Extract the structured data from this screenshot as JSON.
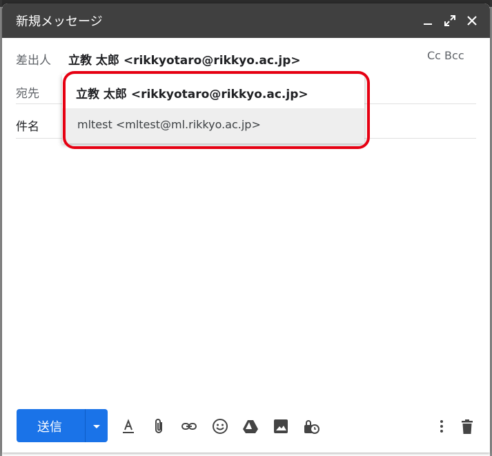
{
  "window": {
    "title": "新規メッセージ"
  },
  "header": {
    "from_label": "差出人",
    "from_value": "立教 太郎 <rikkyotaro@rikkyo.ac.jp>",
    "cc_bcc": "Cc Bcc",
    "to_label": "宛先",
    "subject_label": "件名"
  },
  "from_dropdown": {
    "options": [
      {
        "label": "立教 太郎 <rikkyotaro@rikkyo.ac.jp>"
      },
      {
        "label": "mltest <mltest@ml.rikkyo.ac.jp>"
      }
    ]
  },
  "toolbar": {
    "send_label": "送信",
    "icons": [
      "format-text-icon",
      "attach-icon",
      "link-icon",
      "emoji-icon",
      "drive-icon",
      "image-icon",
      "confidential-icon",
      "more-options-icon",
      "trash-icon"
    ]
  },
  "colors": {
    "titlebar": "#404040",
    "send_button": "#1a73e8",
    "highlight": "#e60012"
  }
}
